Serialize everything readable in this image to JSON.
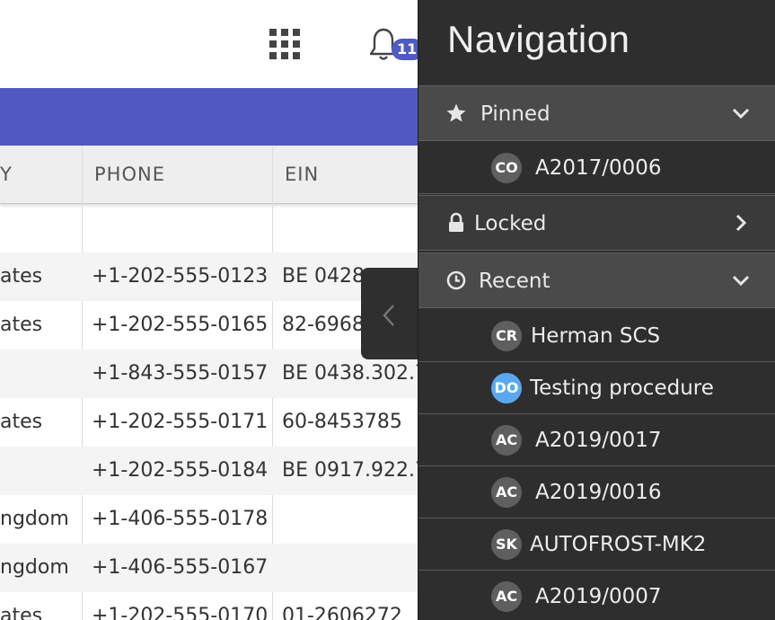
{
  "header": {
    "notification_count": "11"
  },
  "table": {
    "columns": [
      "Y",
      "PHONE",
      "EIN"
    ],
    "rows": [
      {
        "country": "",
        "phone": "",
        "ein": ""
      },
      {
        "country": "ates",
        "phone": "+1-202-555-0123",
        "ein": "BE 0428"
      },
      {
        "country": "ates",
        "phone": "+1-202-555-0165",
        "ein": "82-6968"
      },
      {
        "country": "",
        "phone": "+1-843-555-0157",
        "ein": "BE 0438.302.7"
      },
      {
        "country": "ates",
        "phone": "+1-202-555-0171",
        "ein": "60-8453785"
      },
      {
        "country": "",
        "phone": "+1-202-555-0184",
        "ein": "BE 0917.922.7"
      },
      {
        "country": "ngdom",
        "phone": "+1-406-555-0178",
        "ein": ""
      },
      {
        "country": "ngdom",
        "phone": "+1-406-555-0167",
        "ein": ""
      },
      {
        "country": "ates",
        "phone": "+1-202-555-0170",
        "ein": "01-2606272"
      }
    ]
  },
  "nav": {
    "title": "Navigation",
    "pinned": {
      "label": "Pinned",
      "items": [
        {
          "badge": "CO",
          "label": "A2017/0006"
        }
      ]
    },
    "locked": {
      "label": "Locked"
    },
    "recent": {
      "label": "Recent",
      "items": [
        {
          "badge": "CR",
          "label": "Herman SCS"
        },
        {
          "badge": "DO",
          "label": "Testing procedure"
        },
        {
          "badge": "AC",
          "label": "A2019/0017"
        },
        {
          "badge": "AC",
          "label": "A2019/0016"
        },
        {
          "badge": "SK",
          "label": "AUTOFROST-MK2"
        },
        {
          "badge": "AC",
          "label": "A2019/0007"
        }
      ]
    }
  },
  "colors": {
    "accent": "#5058c2",
    "nav_bg": "#2e2e2e",
    "section_bg": "#4a4a4a",
    "badge_blue": "#5aa9f0"
  },
  "icons": {
    "apps": "grid-icon",
    "notifications": "bell-icon",
    "pinned": "star-icon",
    "locked": "lock-icon",
    "recent": "clock-icon",
    "collapse": "chevron-left-icon"
  }
}
